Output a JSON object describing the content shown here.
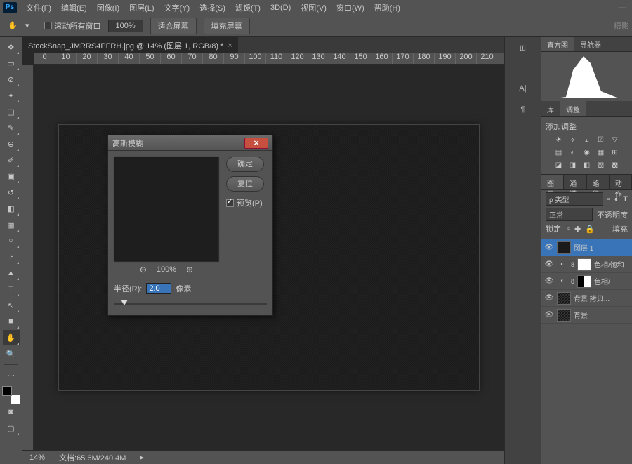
{
  "menubar": {
    "items": [
      "文件(F)",
      "编辑(E)",
      "图像(I)",
      "图层(L)",
      "文字(Y)",
      "选择(S)",
      "滤镜(T)",
      "3D(D)",
      "视图(V)",
      "窗口(W)",
      "帮助(H)"
    ]
  },
  "optionsbar": {
    "scroll_all": "滚动所有窗口",
    "zoom": "100%",
    "fit_screen": "适合屏幕",
    "fill_screen": "填充屏幕",
    "right_label": "摄影"
  },
  "document": {
    "tab_title": "StockSnap_JMRRS4PFRH.jpg @ 14% (图层 1, RGB/8) *",
    "ruler_marks": [
      "0",
      "10",
      "20",
      "30",
      "40",
      "50",
      "60",
      "70",
      "80",
      "90",
      "100",
      "110",
      "120",
      "130",
      "140",
      "150",
      "160",
      "170",
      "180",
      "190",
      "200",
      "210"
    ]
  },
  "statusbar": {
    "zoom": "14%",
    "doc_info": "文档:65.6M/240.4M"
  },
  "dialog": {
    "title": "高斯模糊",
    "ok": "确定",
    "reset": "复位",
    "preview": "预览(P)",
    "zoom_pct": "100%",
    "radius_label": "半径(R):",
    "radius_value": "2.0",
    "radius_unit": "像素"
  },
  "rightpanel": {
    "histo_tabs": [
      "直方图",
      "导航器"
    ],
    "lib_tabs": [
      "库",
      "调整"
    ],
    "add_adjust": "添加调整",
    "layers_tabs": [
      "图层",
      "通道",
      "路径",
      "动作"
    ],
    "kind_label": "ρ 类型",
    "blend_mode": "正常",
    "opacity_label": "不透明度",
    "lock_label": "锁定:",
    "fill_label": "填充",
    "layers": [
      {
        "name": "图层 1"
      },
      {
        "name": "色相/饱和"
      },
      {
        "name": "色相/"
      },
      {
        "name": "背景 拷贝..."
      },
      {
        "name": "背景"
      }
    ]
  }
}
